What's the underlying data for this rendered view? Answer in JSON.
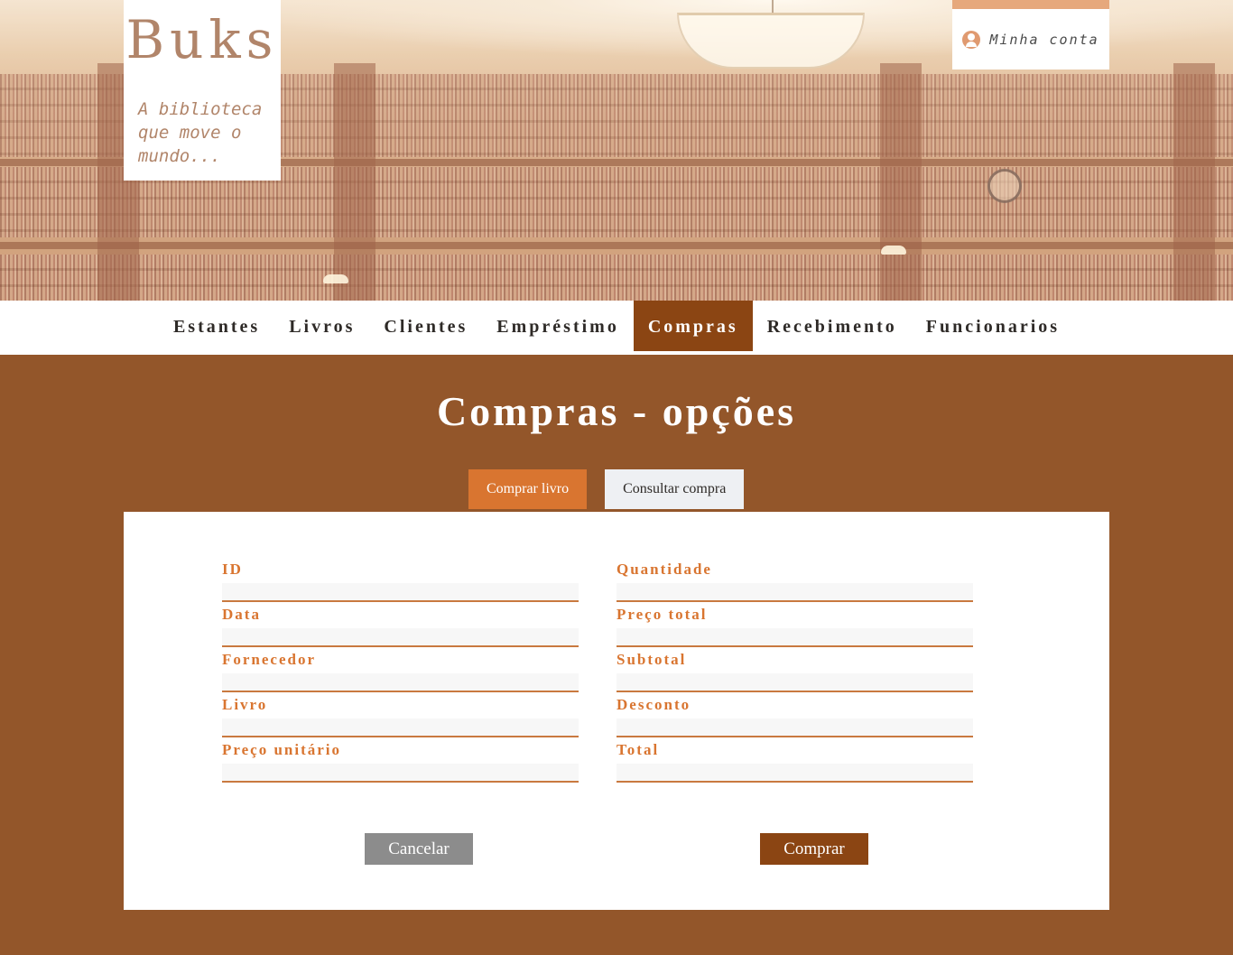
{
  "brand": {
    "name": "Buks",
    "tagline": "A biblioteca que move o mundo..."
  },
  "account": {
    "label": "Minha conta",
    "icon": "user-circle-icon"
  },
  "nav": {
    "items": [
      {
        "label": "Estantes"
      },
      {
        "label": "Livros"
      },
      {
        "label": "Clientes"
      },
      {
        "label": "Empréstimo"
      },
      {
        "label": "Compras"
      },
      {
        "label": "Recebimento"
      },
      {
        "label": "Funcionarios"
      }
    ],
    "active": "Compras"
  },
  "page": {
    "title": "Compras - opções"
  },
  "tabs": {
    "buy": "Comprar livro",
    "consult": "Consultar compra",
    "active": "Comprar livro"
  },
  "form": {
    "left": [
      {
        "label": "ID",
        "value": ""
      },
      {
        "label": "Data",
        "value": ""
      },
      {
        "label": "Fornecedor",
        "value": ""
      },
      {
        "label": "Livro",
        "value": ""
      },
      {
        "label": "Preço unitário",
        "value": ""
      }
    ],
    "right": [
      {
        "label": "Quantidade",
        "value": ""
      },
      {
        "label": "Preço total",
        "value": ""
      },
      {
        "label": "Subtotal",
        "value": ""
      },
      {
        "label": "Desconto",
        "value": ""
      },
      {
        "label": "Total",
        "value": ""
      }
    ],
    "cancel_label": "Cancelar",
    "submit_label": "Comprar"
  },
  "colors": {
    "brown": "#93562a",
    "nav_active": "#8b4513",
    "accent_orange": "#d97530",
    "brand_text": "#b1856a",
    "cancel_gray": "#8c8c8c"
  }
}
